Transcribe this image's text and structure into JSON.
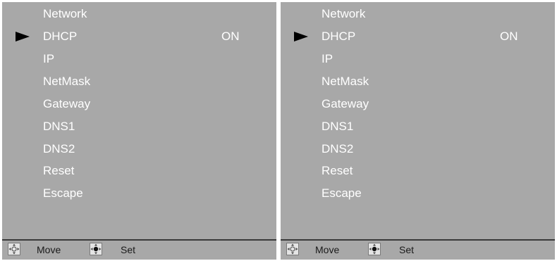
{
  "panels": [
    {
      "menu": {
        "items": [
          {
            "label": "Network",
            "value": ""
          },
          {
            "label": "DHCP",
            "value": "ON"
          },
          {
            "label": "IP",
            "value": ""
          },
          {
            "label": "NetMask",
            "value": ""
          },
          {
            "label": "Gateway",
            "value": ""
          },
          {
            "label": "DNS1",
            "value": ""
          },
          {
            "label": "DNS2",
            "value": ""
          },
          {
            "label": "Reset",
            "value": ""
          },
          {
            "label": "Escape",
            "value": ""
          }
        ],
        "selected_index": 1
      },
      "footer": {
        "move_label": "Move",
        "set_label": "Set",
        "move_icon": "dpad-move-icon",
        "set_icon": "dpad-set-icon"
      }
    },
    {
      "menu": {
        "items": [
          {
            "label": "Network",
            "value": ""
          },
          {
            "label": "DHCP",
            "value": "ON"
          },
          {
            "label": "IP",
            "value": ""
          },
          {
            "label": "NetMask",
            "value": ""
          },
          {
            "label": "Gateway",
            "value": ""
          },
          {
            "label": "DNS1",
            "value": ""
          },
          {
            "label": "DNS2",
            "value": ""
          },
          {
            "label": "Reset",
            "value": ""
          },
          {
            "label": "Escape",
            "value": ""
          }
        ],
        "selected_index": 1
      },
      "footer": {
        "move_label": "Move",
        "set_label": "Set",
        "move_icon": "dpad-move-icon",
        "set_icon": "dpad-set-icon"
      }
    }
  ],
  "colors": {
    "panel_background": "#a8a8a8",
    "text": "#ffffff",
    "cursor": "#000000",
    "footer_text": "#1a1a1a"
  }
}
